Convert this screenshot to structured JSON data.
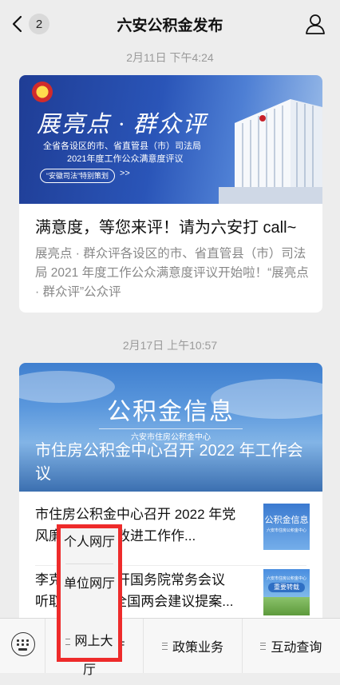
{
  "header": {
    "back_badge": "2",
    "title": "六安公积金发布"
  },
  "messages": [
    {
      "timestamp": "2月11日 下午4:24",
      "banner": {
        "title": "展亮点 · 群众评",
        "line1": "全省各设区的市、省直管县（市）司法局",
        "line2": "2021年度工作公众满意度评议",
        "pill": "“安徽司法”特别策划",
        "arrows": ">>"
      },
      "headline": "满意度，等您来评！请为六安打 call~",
      "description": "展亮点 · 群众评各设区的市、省直管县（市）司法局 2021 年度工作公众满意度评议开始啦！“展亮点 · 群众评”公众评"
    },
    {
      "timestamp": "2月17日 上午10:57",
      "banner": {
        "title": "公积金信息",
        "subtitle": "六安市住房公积金中心",
        "caption": "市住房公积金中心召开 2022 年工作会议"
      },
      "items": [
        {
          "text": "市住房公积金中心召开 2022 年党风廉政建设暨改进工作作...",
          "thumb_title": "公积金信息",
          "thumb_sub": "六安市住房公积金中心"
        },
        {
          "text": "李克强主持召开国务院常务会议 听取 2021 年全国两会建议提案...",
          "thumb_title": "重要转载",
          "thumb_sub": "六安市住房公积金中心"
        }
      ]
    }
  ],
  "popup_menu": {
    "items": [
      "个人网厅",
      "单位网厅"
    ]
  },
  "bottom_menu": {
    "tabs": [
      "网上大厅",
      "政策业务",
      "互动查询"
    ]
  },
  "colors": {
    "highlight_border": "#ee2b2b"
  }
}
